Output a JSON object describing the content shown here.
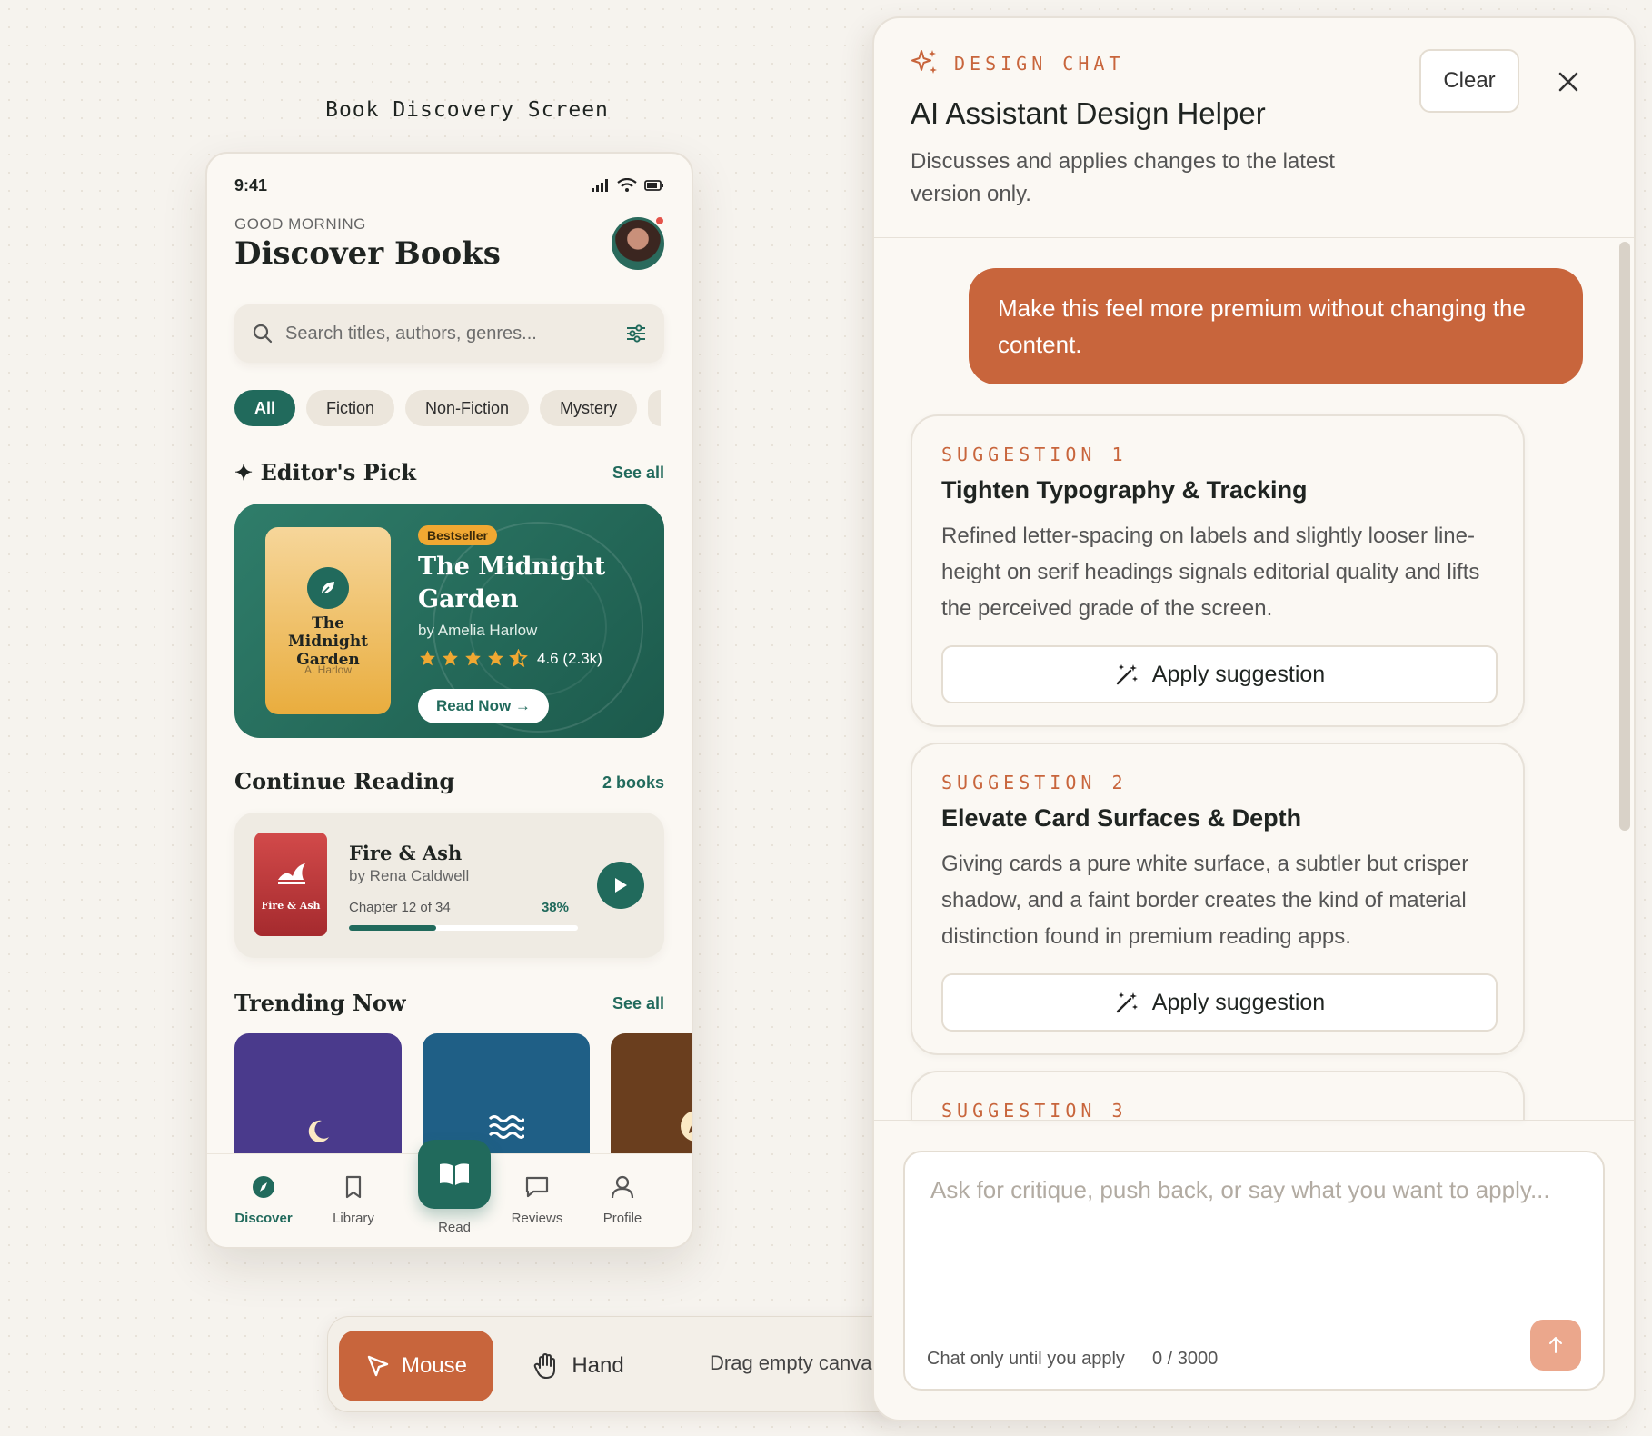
{
  "canvas": {
    "label": "Book Discovery Screen"
  },
  "phone": {
    "status_time": "9:41",
    "greeting": "GOOD MORNING",
    "title": "Discover Books",
    "search_placeholder": "Search titles, authors, genres...",
    "chips": [
      {
        "label": "All",
        "active": true
      },
      {
        "label": "Fiction",
        "active": false
      },
      {
        "label": "Non-Fiction",
        "active": false
      },
      {
        "label": "Mystery",
        "active": false
      }
    ],
    "editors_pick": {
      "section_title": "✦ Editor's Pick",
      "see_all": "See all",
      "badge": "Bestseller",
      "title": "The Midnight Garden",
      "author": "by Amelia Harlow",
      "cover_title": "The Midnight Garden",
      "cover_author": "A. Harlow",
      "rating_value": 4.5,
      "rating_text": "4.6 (2.3k)",
      "cta": "Read Now →"
    },
    "continue_reading": {
      "section_title": "Continue Reading",
      "count": "2 books",
      "book_title": "Fire & Ash",
      "cover_text": "Fire & Ash",
      "author": "by Rena Caldwell",
      "chapter": "Chapter 12 of 34",
      "percent_label": "38%",
      "progress": 0.38
    },
    "trending": {
      "section_title": "Trending Now",
      "see_all": "See all",
      "covers": [
        {
          "color": "#4a3a8c",
          "icon": "moon-icon"
        },
        {
          "color": "#1f5f86",
          "icon": "waves-icon"
        },
        {
          "color": "#6a3e1e",
          "icon": "feather-icon"
        }
      ]
    },
    "nav": {
      "discover": "Discover",
      "library": "Library",
      "read": "Read",
      "reviews": "Reviews",
      "profile": "Profile"
    }
  },
  "toolbar": {
    "mouse": "Mouse",
    "hand": "Hand",
    "hint": "Drag empty canva"
  },
  "chat": {
    "eyebrow": "DESIGN CHAT",
    "title": "AI Assistant Design Helper",
    "subtitle": "Discusses and applies changes to the latest version only.",
    "clear": "Clear",
    "user_message": "Make this feel more premium without changing the content.",
    "suggestions": [
      {
        "label": "SUGGESTION 1",
        "title": "Tighten Typography & Tracking",
        "body": "Refined letter-spacing on labels and slightly looser line-height on serif headings signals editorial quality and lifts the perceived grade of the screen.",
        "button": "Apply suggestion"
      },
      {
        "label": "SUGGESTION 2",
        "title": "Elevate Card Surfaces & Depth",
        "body": "Giving cards a pure white surface, a subtler but crisper shadow, and a faint border creates the kind of material distinction found in premium reading apps.",
        "button": "Apply suggestion"
      },
      {
        "label": "SUGGESTION 3"
      }
    ],
    "composer_placeholder": "Ask for critique, push back, or say what you want to apply...",
    "composer_hint": "Chat only until you apply",
    "composer_count": "0 / 3000"
  },
  "colors": {
    "accent": "#c8653c",
    "primary": "#216a5c",
    "gold": "#f0a832"
  }
}
